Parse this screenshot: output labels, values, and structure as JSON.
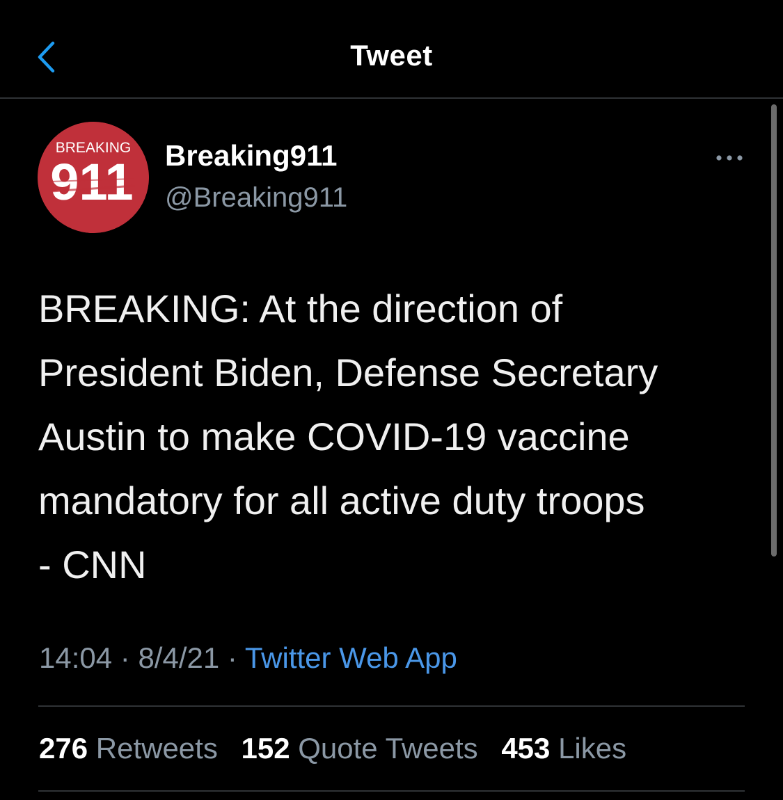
{
  "header": {
    "title": "Tweet",
    "back_icon": "chevron-left-icon",
    "accent": "#1d9bf0"
  },
  "tweet": {
    "avatar": {
      "top_text": "BREAKING",
      "number": "911",
      "color": "#c0303a"
    },
    "display_name": "Breaking911",
    "handle": "@Breaking911",
    "more_icon": "more-horizontal-icon",
    "text_lines": [
      "BREAKING: At the direction of",
      "President Biden, Defense Secretary",
      "Austin to make COVID-19 vaccine",
      "mandatory for all active duty troops",
      "- CNN"
    ],
    "time": "14:04",
    "date": "8/4/21",
    "separator": "·",
    "source": "Twitter Web App"
  },
  "stats": {
    "retweets": {
      "count": "276",
      "label": "Retweets"
    },
    "quote_tweets": {
      "count": "152",
      "label": "Quote Tweets"
    },
    "likes": {
      "count": "453",
      "label": "Likes"
    }
  }
}
